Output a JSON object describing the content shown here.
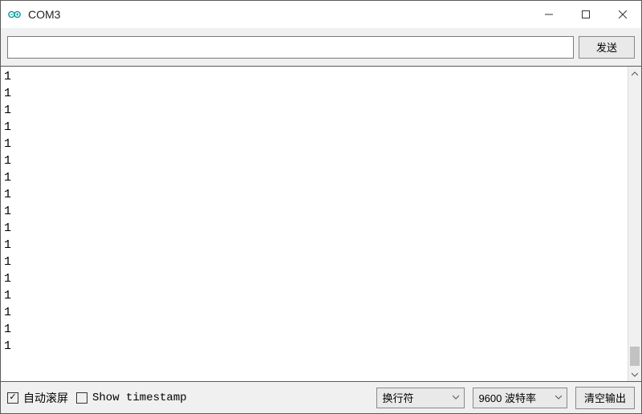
{
  "window": {
    "title": "COM3"
  },
  "sendRow": {
    "input_value": "",
    "send_label": "发送"
  },
  "output": {
    "lines": [
      "1",
      "1",
      "1",
      "1",
      "1",
      "1",
      "1",
      "1",
      "1",
      "1",
      "1",
      "1",
      "1",
      "1",
      "1",
      "1",
      "1"
    ]
  },
  "bottom": {
    "autoscroll": {
      "label": "自动滚屏",
      "checked": true
    },
    "timestamp": {
      "label": "Show timestamp",
      "checked": false
    },
    "line_ending": {
      "selected": "换行符"
    },
    "baud": {
      "selected": "9600 波特率"
    },
    "clear_label": "清空输出"
  }
}
